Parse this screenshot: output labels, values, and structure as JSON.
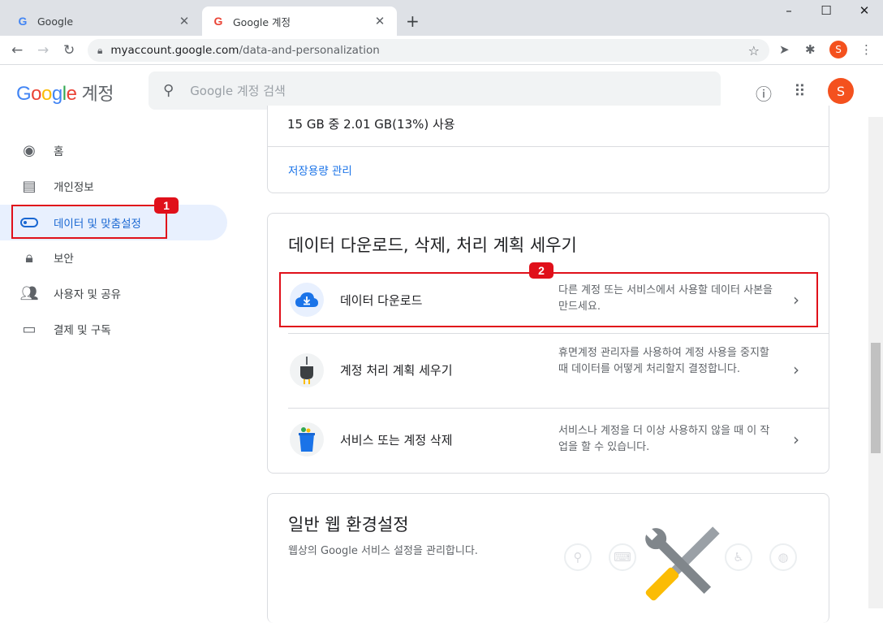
{
  "browser": {
    "tabs": [
      {
        "title": "Google",
        "favicon": "google-g-icon"
      },
      {
        "title": "Google 계정",
        "favicon": "google-g-icon"
      }
    ],
    "new_tab": "+",
    "url_host": "myaccount.google.com",
    "url_path": "/data-and-personalization",
    "profile_initial": "S",
    "window_controls": {
      "minimize": "–",
      "maximize": "☐",
      "close": "✕"
    }
  },
  "header": {
    "logo": {
      "G": "G",
      "o1": "o",
      "o2": "o",
      "g": "g",
      "l": "l",
      "e": "e",
      "suffix": "계정"
    },
    "search_placeholder": "Google 계정 검색",
    "avatar_initial": "S"
  },
  "sidebar": {
    "items": [
      {
        "label": "홈",
        "icon": "account-circle-icon"
      },
      {
        "label": "개인정보",
        "icon": "id-card-icon"
      },
      {
        "label": "데이터 및 맞춤설정",
        "icon": "toggle-icon",
        "selected": true
      },
      {
        "label": "보안",
        "icon": "lock-icon"
      },
      {
        "label": "사용자 및 공유",
        "icon": "people-icon"
      },
      {
        "label": "결제 및 구독",
        "icon": "credit-card-icon"
      }
    ]
  },
  "annotations": {
    "one": "1",
    "two": "2"
  },
  "storage": {
    "usage": "15 GB 중 2.01 GB(13%) 사용",
    "manage_link": "저장용량 관리"
  },
  "download_section": {
    "title": "데이터 다운로드, 삭제, 처리 계획 세우기",
    "rows": [
      {
        "title": "데이터 다운로드",
        "desc": "다른 계정 또는 서비스에서 사용할 데이터 사본을 만드세요."
      },
      {
        "title": "계정 처리 계획 세우기",
        "desc": "휴면계정 관리자를 사용하여 계정 사용을 중지할 때 데이터를 어떻게 처리할지 결정합니다."
      },
      {
        "title": "서비스 또는 계정 삭제",
        "desc": "서비스나 계정을 더 이상 사용하지 않을 때 이 작업을 할 수 있습니다."
      }
    ]
  },
  "web_prefs": {
    "title": "일반 웹 환경설정",
    "subtitle": "웹상의 Google 서비스 설정을 관리합니다."
  },
  "colors": {
    "accent": "#1967d2",
    "annotation": "#e0101a",
    "avatar": "#f4511e"
  }
}
